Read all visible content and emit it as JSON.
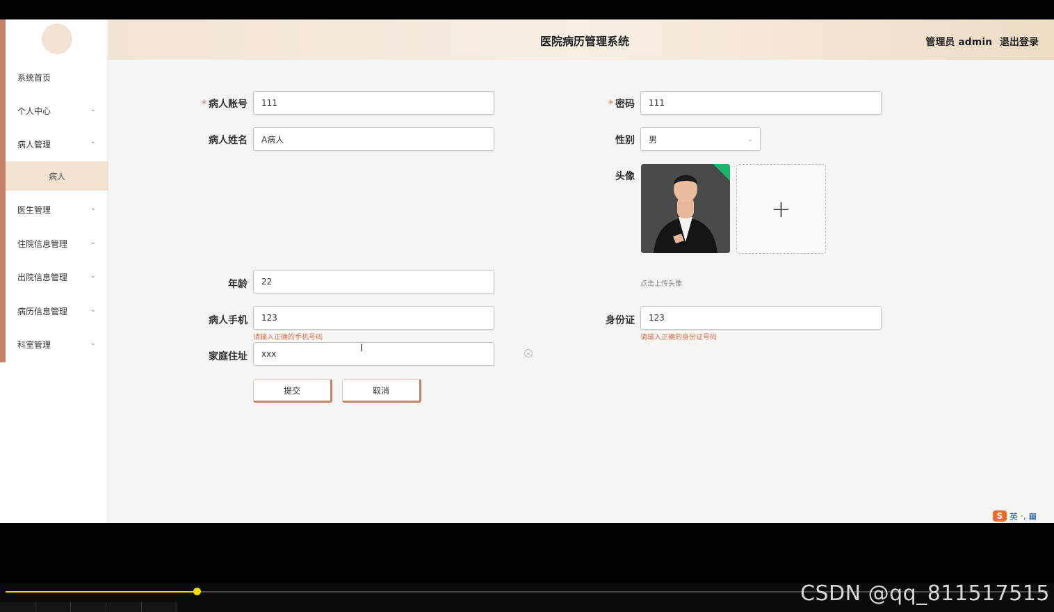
{
  "header": {
    "title": "医院病历管理系统",
    "user_label": "管理员 admin",
    "logout_label": "退出登录"
  },
  "sidebar": {
    "items": [
      {
        "label": "系统首页",
        "expandable": false
      },
      {
        "label": "个人中心",
        "expandable": true
      },
      {
        "label": "病人管理",
        "expandable": true,
        "expanded": true
      },
      {
        "label": "医生管理",
        "expandable": true
      },
      {
        "label": "住院信息管理",
        "expandable": true
      },
      {
        "label": "出院信息管理",
        "expandable": true
      },
      {
        "label": "病历信息管理",
        "expandable": true
      },
      {
        "label": "科室管理",
        "expandable": true
      }
    ],
    "active_subitem": "病人"
  },
  "form": {
    "account_label": "病人账号",
    "account_value": "111",
    "password_label": "密码",
    "password_value": "111",
    "name_label": "病人姓名",
    "name_value": "A病人",
    "gender_label": "性别",
    "gender_value": "男",
    "avatar_label": "头像",
    "avatar_hint": "点击上传头像",
    "age_label": "年龄",
    "age_value": "22",
    "phone_label": "病人手机",
    "phone_value": "123",
    "phone_error": "请输入正确的手机号码",
    "idcard_label": "身份证",
    "idcard_value": "123",
    "idcard_error": "请输入正确的身份证号码",
    "address_label": "家庭住址",
    "address_value": "xxx",
    "required_mark": "*"
  },
  "buttons": {
    "submit": "提交",
    "cancel": "取消"
  },
  "ime": {
    "mode": "英"
  },
  "player": {
    "progress": 0.183
  },
  "watermark": "CSDN @qq_811517515",
  "colors": {
    "accent": "#c8826a",
    "error": "#e0704e",
    "header_bg": "#f1e5d4",
    "progress": "#e8d900"
  }
}
